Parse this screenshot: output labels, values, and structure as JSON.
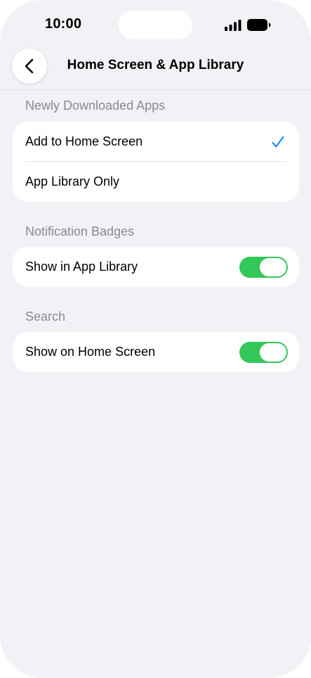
{
  "status_bar": {
    "time": "10:00"
  },
  "nav": {
    "back_icon": "chevron-left-icon",
    "title": "Home Screen & App Library"
  },
  "sections": [
    {
      "header": "Newly Downloaded Apps",
      "rows": [
        {
          "label": "Add to Home Screen",
          "selected": true
        },
        {
          "label": "App Library Only",
          "selected": false
        }
      ]
    },
    {
      "header": "Notification Badges",
      "rows": [
        {
          "label": "Show in App Library",
          "toggle_on": true
        }
      ]
    },
    {
      "header": "Search",
      "rows": [
        {
          "label": "Show on Home Screen",
          "toggle_on": true
        }
      ]
    }
  ],
  "colors": {
    "background": "#f2f1f6",
    "toggle_on": "#34c759",
    "checkmark": "#1a8cff",
    "section_header": "#8a8a8e"
  }
}
